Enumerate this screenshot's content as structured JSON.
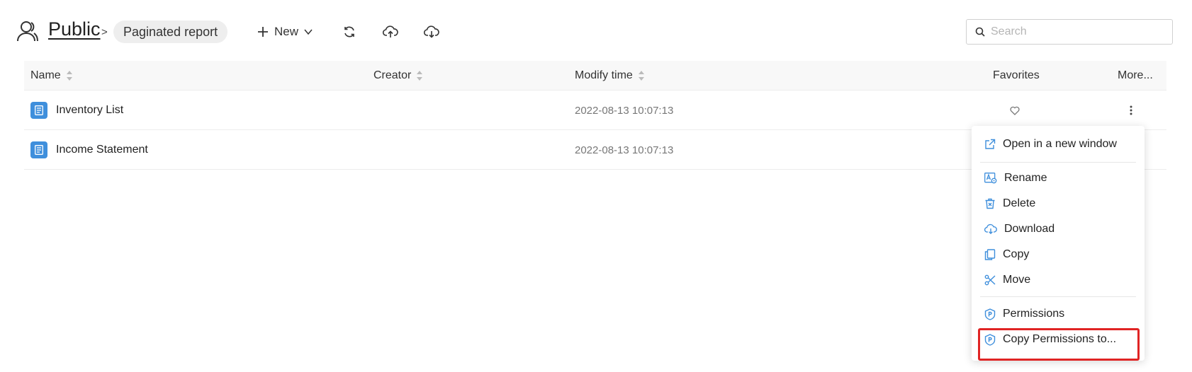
{
  "breadcrumb": {
    "root": "Public",
    "separator": ">",
    "current": "Paginated report"
  },
  "toolbar": {
    "new_label": "New",
    "icons": [
      "plus-icon",
      "chevron-down-icon",
      "refresh-icon",
      "upload-cloud-icon",
      "download-cloud-icon"
    ]
  },
  "search": {
    "placeholder": "Search",
    "value": ""
  },
  "table": {
    "columns": {
      "name": "Name",
      "creator": "Creator",
      "modify_time": "Modify time",
      "favorites": "Favorites",
      "more": "More..."
    },
    "rows": [
      {
        "name": "Inventory List",
        "creator": "",
        "modify_time": "2022-08-13 10:07:13"
      },
      {
        "name": "Income Statement",
        "creator": "",
        "modify_time": "2022-08-13 10:07:13"
      }
    ]
  },
  "context_menu": {
    "items": [
      {
        "label": "Open in a new window",
        "icon": "external-link-icon"
      },
      {
        "label": "Rename",
        "icon": "rename-icon"
      },
      {
        "label": "Delete",
        "icon": "trash-icon"
      },
      {
        "label": "Download",
        "icon": "download-cloud-icon"
      },
      {
        "label": "Copy",
        "icon": "copy-icon"
      },
      {
        "label": "Move",
        "icon": "scissors-icon"
      },
      {
        "label": "Permissions",
        "icon": "shield-icon"
      },
      {
        "label": "Copy Permissions to...",
        "icon": "shield-icon"
      }
    ],
    "highlighted_item": "Copy Permissions to..."
  },
  "colors": {
    "accent": "#3f8fdc",
    "highlight_border": "#e02424",
    "header_bg": "#f8f8f8"
  }
}
